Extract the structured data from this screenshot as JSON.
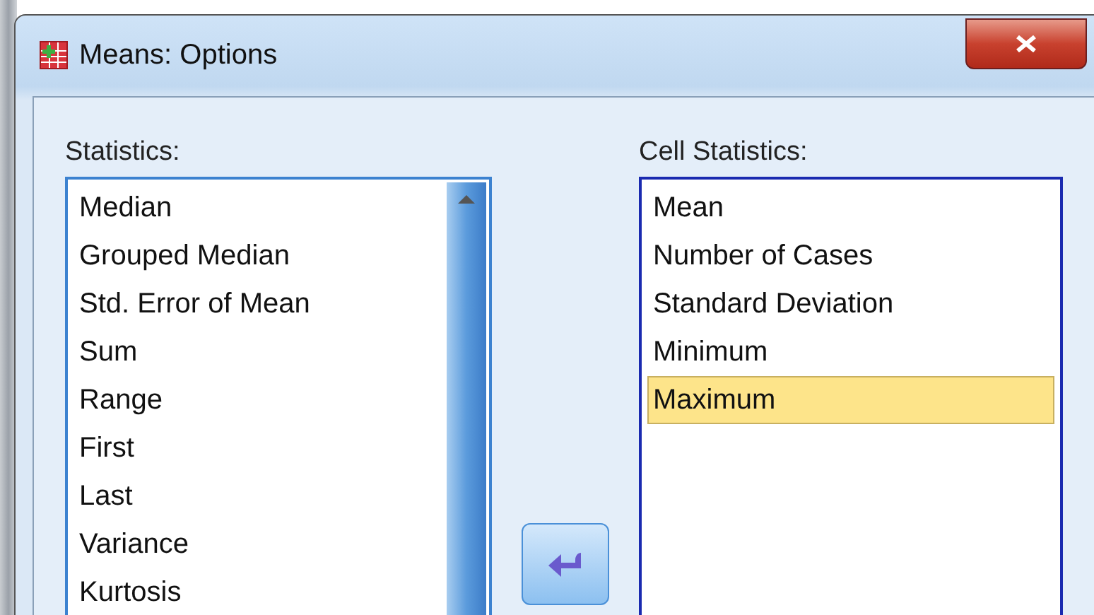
{
  "window": {
    "title": "Means: Options"
  },
  "statistics": {
    "label": "Statistics:",
    "items": [
      {
        "label": "Median",
        "selected": false
      },
      {
        "label": "Grouped Median",
        "selected": false
      },
      {
        "label": "Std. Error of Mean",
        "selected": false
      },
      {
        "label": "Sum",
        "selected": false
      },
      {
        "label": "Range",
        "selected": false
      },
      {
        "label": "First",
        "selected": false
      },
      {
        "label": "Last",
        "selected": false
      },
      {
        "label": "Variance",
        "selected": false
      },
      {
        "label": "Kurtosis",
        "selected": false
      }
    ]
  },
  "cell_statistics": {
    "label": "Cell Statistics:",
    "items": [
      {
        "label": "Mean",
        "selected": false
      },
      {
        "label": "Number of Cases",
        "selected": false
      },
      {
        "label": "Standard Deviation",
        "selected": false
      },
      {
        "label": "Minimum",
        "selected": false
      },
      {
        "label": "Maximum",
        "selected": true
      }
    ]
  }
}
